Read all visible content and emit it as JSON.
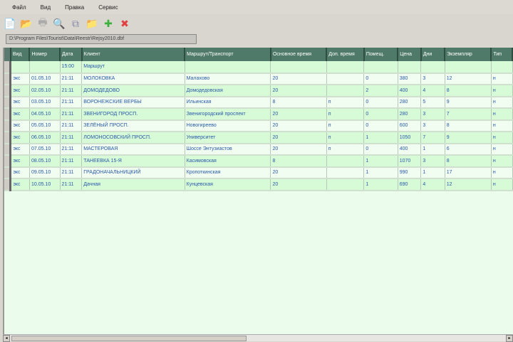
{
  "menu": [
    "Файл",
    "Вид",
    "Правка",
    "Сервис"
  ],
  "toolbar": [
    {
      "name": "new-icon",
      "glyph": "📄",
      "color": "#e8eef8"
    },
    {
      "name": "open-icon",
      "glyph": "📂",
      "color": "#f0b050"
    },
    {
      "name": "print-icon",
      "glyph": "🖶",
      "color": "#aaa"
    },
    {
      "name": "preview-icon",
      "glyph": "🔍",
      "color": "#8aa"
    },
    {
      "name": "copy-icon",
      "glyph": "⧉",
      "color": "#88a"
    },
    {
      "name": "folder-icon",
      "glyph": "📁",
      "color": "#f0b050"
    },
    {
      "name": "add-icon",
      "glyph": "✚",
      "color": "#3bb03b"
    },
    {
      "name": "delete-icon",
      "glyph": "✖",
      "color": "#e04040"
    }
  ],
  "path": "D:\\Program Files\\Tourist\\Data\\Reestr\\Rejsy2010.dbf",
  "table": {
    "headers": [
      "Вид",
      "Номер",
      "Дата",
      "Клиент",
      "Маршрут/Транспорт",
      "Основное время",
      "Доп. время",
      "Помещ.",
      "Цена",
      "Дни",
      "Экземпляр",
      "Тип"
    ],
    "rows": [
      [
        "",
        "",
        "15:00",
        "Маршрут",
        "",
        "",
        "",
        "",
        "",
        "",
        "",
        ""
      ],
      [
        "экс",
        "01.05.10",
        "21:11",
        "МОЛОКОВКА",
        "Малахово",
        "20",
        "",
        "0",
        "380",
        "3",
        "12",
        "н"
      ],
      [
        "экс",
        "02.05.10",
        "21:11",
        "ДОМОДЕДОВО",
        "Домодедовская",
        "20",
        "",
        "2",
        "400",
        "4",
        "8",
        "н"
      ],
      [
        "экс",
        "03.05.10",
        "21:11",
        "ВОРОНЕЖСКИЕ ВЕРБЫ",
        "Ильинская",
        "8",
        "п",
        "0",
        "280",
        "5",
        "9",
        "н"
      ],
      [
        "экс",
        "04.05.10",
        "21:11",
        "ЗВЕНИГОРОД ПРОСП.",
        "Звенигородский проспект",
        "20",
        "п",
        "0",
        "280",
        "3",
        "7",
        "н"
      ],
      [
        "экс",
        "05.05.10",
        "21:11",
        "ЗЕЛЁНЫЙ ПРОСП.",
        "Новогиреево",
        "20",
        "п",
        "0",
        "600",
        "3",
        "8",
        "н"
      ],
      [
        "экс",
        "06.05.10",
        "21:11",
        "ЛОМОНОСОВСКИЙ ПРОСП.",
        "Университет",
        "20",
        "п",
        "1",
        "1050",
        "7",
        "9",
        "н"
      ],
      [
        "экс",
        "07.05.10",
        "21:11",
        "МАСТЕРОВАЯ",
        "Шоссе Энтузиастов",
        "20",
        "п",
        "0",
        "400",
        "1",
        "6",
        "н"
      ],
      [
        "экс",
        "08.05.10",
        "21:11",
        "ТАНЕЕВКА 15-Я",
        "Касимовская",
        "8",
        "",
        "1",
        "1070",
        "3",
        "8",
        "н"
      ],
      [
        "экс",
        "09.05.10",
        "21:11",
        "ГРАДОНАЧАЛЬНИЦКИЙ",
        "Кропоткинская",
        "20",
        "",
        "1",
        "990",
        "1",
        "17",
        "н"
      ],
      [
        "экс",
        "10.05.10",
        "21:11",
        "Дачная",
        "Кунцевская",
        "20",
        "",
        "1",
        "690",
        "4",
        "12",
        "н"
      ]
    ]
  }
}
